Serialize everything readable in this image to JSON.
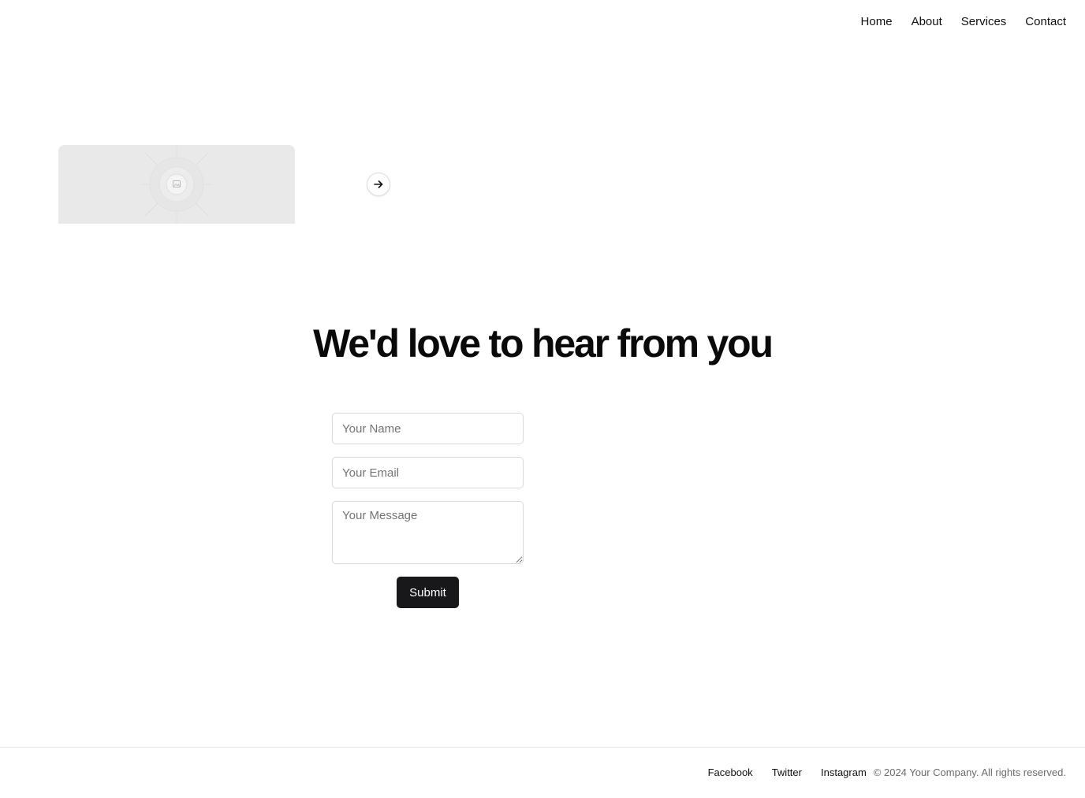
{
  "nav": {
    "items": [
      {
        "label": "Home"
      },
      {
        "label": "About"
      },
      {
        "label": "Services"
      },
      {
        "label": "Contact"
      }
    ]
  },
  "hero": {
    "image_icon": "image-placeholder-icon",
    "next_icon": "arrow-right-icon"
  },
  "contact": {
    "heading": "We'd love to hear from you",
    "name_placeholder": "Your Name",
    "email_placeholder": "Your Email",
    "message_placeholder": "Your Message",
    "submit_label": "Submit"
  },
  "footer": {
    "links": [
      {
        "label": "Facebook"
      },
      {
        "label": "Twitter"
      },
      {
        "label": "Instagram"
      }
    ],
    "copyright": "© 2024 Your Company. All rights reserved."
  },
  "colors": {
    "background": "#ffffff",
    "text": "#111111",
    "button": "#18181b",
    "muted": "#6b6b6b",
    "border": "#dadada",
    "placeholder_bg": "#e9e9e9"
  }
}
